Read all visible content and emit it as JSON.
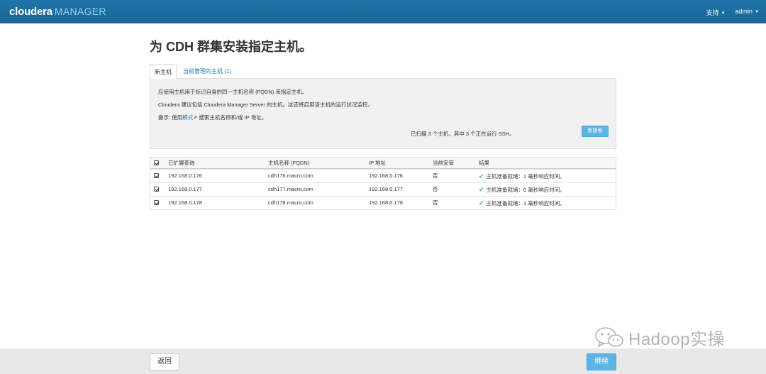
{
  "header": {
    "brand_main": "cloudera",
    "brand_sub": "MANAGER",
    "support_label": "支持",
    "user_label": "admin"
  },
  "page": {
    "title": "为 CDH 群集安装指定主机。"
  },
  "tabs": [
    {
      "label": "新主机",
      "active": true
    },
    {
      "label": "当前管理的主机 (1)",
      "active": false
    }
  ],
  "info": {
    "line1": "应使用主机用于标识自身的同一主机名称 (FQDN) 来指定主机。",
    "line2": "Cloudera 建议包括 Cloudera Manager Server 的主机。这还将启用该主机的运行状况监控。",
    "hint_prefix": "提示: 使用",
    "hint_link": "模式",
    "hint_suffix": " 搜索主机名称和/或 IP 地址。",
    "scan_status": "已扫描 3 个主机，其中 3 个正在运行 SSH。",
    "new_search_label": "新搜索"
  },
  "table": {
    "headers": [
      "已扩展查询",
      "主机名称 (FQDN)",
      "IP 地址",
      "当前安管",
      "结果"
    ],
    "rows": [
      {
        "checked": true,
        "query": "192.168.0.176",
        "fqdn": "cdh176.macro.com",
        "ip": "192.168.0.176",
        "managed": "否",
        "result": "主机准备就绪：1 毫秒响应时间。"
      },
      {
        "checked": true,
        "query": "192.168.0.177",
        "fqdn": "cdh177.macro.com",
        "ip": "192.168.0.177",
        "managed": "否",
        "result": "主机准备就绪：0 毫秒响应时间。"
      },
      {
        "checked": true,
        "query": "192.168.0.178",
        "fqdn": "cdh178.macro.com",
        "ip": "192.168.0.178",
        "managed": "否",
        "result": "主机准备就绪：1 毫秒响应时间。"
      }
    ]
  },
  "footer": {
    "back_label": "返回",
    "continue_label": "继续"
  },
  "watermark": {
    "text": "Hadoop实操"
  },
  "colors": {
    "topbar": "#1c6fa3",
    "accent_button": "#5bb4e5",
    "link": "#2a7ab0",
    "success": "#5cb85c"
  }
}
